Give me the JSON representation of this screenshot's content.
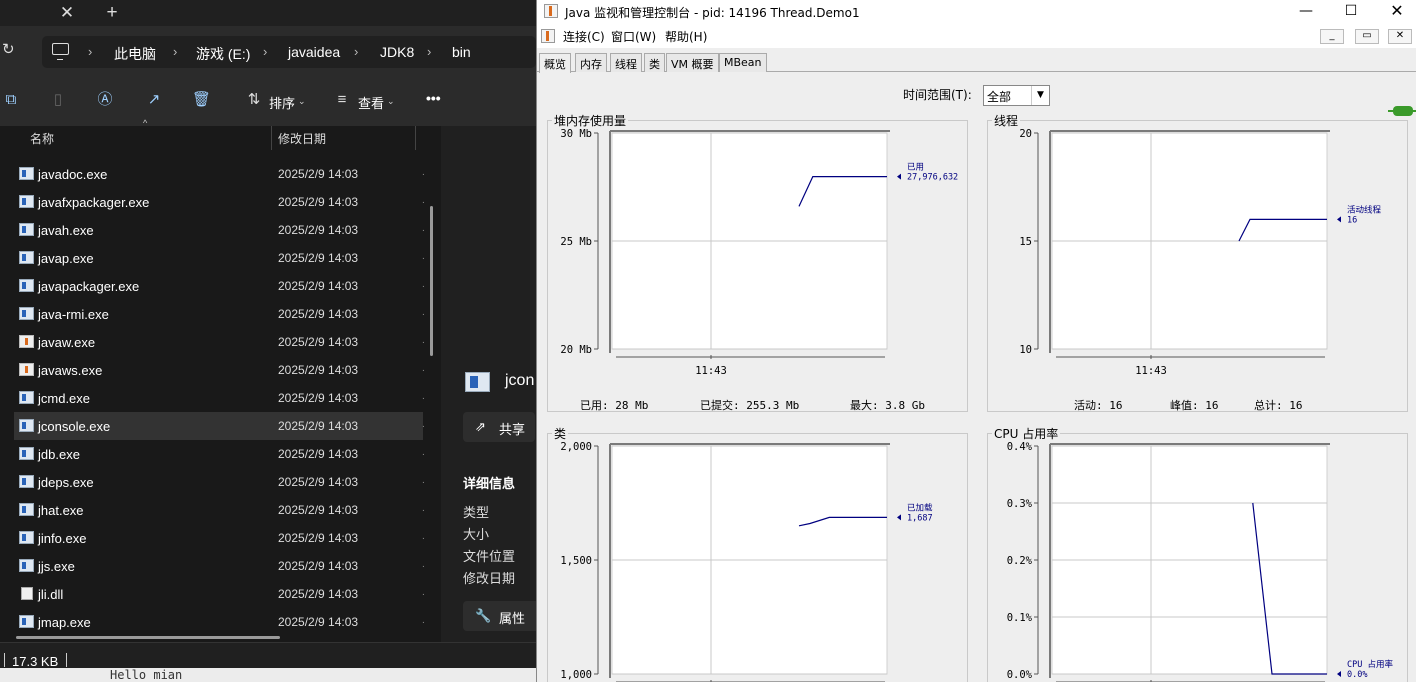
{
  "explorer": {
    "address": {
      "crumbs": [
        "此电脑",
        "游戏 (E:)",
        "javaidea",
        "JDK8",
        "bin"
      ]
    },
    "toolbar": {
      "sort_label": "排序",
      "view_label": "查看",
      "more_label": "•••"
    },
    "columns": {
      "name": "名称",
      "date": "修改日期"
    },
    "files": [
      {
        "name": "javadoc.exe",
        "date": "2025/2/9 14:03",
        "icon": "exe"
      },
      {
        "name": "javafxpackager.exe",
        "date": "2025/2/9 14:03",
        "icon": "exe"
      },
      {
        "name": "javah.exe",
        "date": "2025/2/9 14:03",
        "icon": "exe"
      },
      {
        "name": "javap.exe",
        "date": "2025/2/9 14:03",
        "icon": "exe"
      },
      {
        "name": "javapackager.exe",
        "date": "2025/2/9 14:03",
        "icon": "exe"
      },
      {
        "name": "java-rmi.exe",
        "date": "2025/2/9 14:03",
        "icon": "exe"
      },
      {
        "name": "javaw.exe",
        "date": "2025/2/9 14:03",
        "icon": "java"
      },
      {
        "name": "javaws.exe",
        "date": "2025/2/9 14:03",
        "icon": "java"
      },
      {
        "name": "jcmd.exe",
        "date": "2025/2/9 14:03",
        "icon": "exe"
      },
      {
        "name": "jconsole.exe",
        "date": "2025/2/9 14:03",
        "icon": "exe",
        "selected": true
      },
      {
        "name": "jdb.exe",
        "date": "2025/2/9 14:03",
        "icon": "exe"
      },
      {
        "name": "jdeps.exe",
        "date": "2025/2/9 14:03",
        "icon": "exe"
      },
      {
        "name": "jhat.exe",
        "date": "2025/2/9 14:03",
        "icon": "exe"
      },
      {
        "name": "jinfo.exe",
        "date": "2025/2/9 14:03",
        "icon": "exe"
      },
      {
        "name": "jjs.exe",
        "date": "2025/2/9 14:03",
        "icon": "exe"
      },
      {
        "name": "jli.dll",
        "date": "2025/2/9 14:03",
        "icon": "dll"
      },
      {
        "name": "jmap.exe",
        "date": "2025/2/9 14:03",
        "icon": "exe"
      }
    ],
    "details": {
      "name": "jcon",
      "share_label": "共享",
      "header": "详细信息",
      "labels": [
        "类型",
        "大小",
        "文件位置",
        "修改日期"
      ],
      "properties_label": "属性"
    },
    "status": {
      "size": "17.3 KB"
    },
    "background_text": "Hello mian"
  },
  "jconsole": {
    "title": "Java 监视和管理控制台 - pid: 14196 Thread.Demo1",
    "menu": [
      "连接(C)",
      "窗口(W)",
      "帮助(H)"
    ],
    "tabs": [
      "概览",
      "内存",
      "线程",
      "类",
      "VM 概要",
      "MBean"
    ],
    "time_range_label": "时间范围(T):",
    "time_range_value": "全部",
    "accent": "#000080"
  },
  "chart_data": [
    {
      "type": "line",
      "title": "堆内存使用量",
      "yticks": [
        "30 Mb",
        "25 Mb",
        "20 Mb"
      ],
      "ylim": [
        20,
        30
      ],
      "xlim": [
        0,
        100
      ],
      "xtick": {
        "label": "11:43",
        "x": 36
      },
      "series": [
        {
          "name": "已用",
          "value_label": "27,976,632",
          "x": [
            68,
            73,
            100
          ],
          "y": [
            26.6,
            27.98,
            27.98
          ]
        }
      ],
      "stats": [
        "已用:  28  Mb",
        "已提交:  255.3  Mb",
        "最大:  3.8  Gb"
      ]
    },
    {
      "type": "line",
      "title": "线程",
      "yticks": [
        "20",
        "15",
        "10"
      ],
      "ylim": [
        10,
        20
      ],
      "xlim": [
        0,
        100
      ],
      "xtick": {
        "label": "11:43",
        "x": 36
      },
      "series": [
        {
          "name": "活动线程",
          "value_label": "16",
          "x": [
            68,
            72,
            100
          ],
          "y": [
            15,
            16,
            16
          ]
        }
      ],
      "stats": [
        "活动:  16",
        "峰值:  16",
        "总计:  16"
      ]
    },
    {
      "type": "line",
      "title": "类",
      "yticks": [
        "2,000",
        "1,500",
        "1,000"
      ],
      "ylim": [
        1000,
        2000
      ],
      "xlim": [
        0,
        100
      ],
      "xtick": {
        "label": "",
        "x": 36
      },
      "series": [
        {
          "name": "已加载",
          "value_label": "1,687",
          "x": [
            68,
            72,
            79,
            100
          ],
          "y": [
            1650,
            1660,
            1687,
            1687
          ]
        }
      ],
      "stats": []
    },
    {
      "type": "line",
      "title": "CPU 占用率",
      "yticks": [
        "0.4%",
        "0.3%",
        "0.2%",
        "0.1%",
        "0.0%"
      ],
      "ylim": [
        0,
        0.4
      ],
      "xlim": [
        0,
        100
      ],
      "xtick": {
        "label": "",
        "x": 36
      },
      "series": [
        {
          "name": "CPU 占用率",
          "value_label": "0.0%",
          "x": [
            73,
            80,
            100
          ],
          "y": [
            0.3,
            0.0,
            0.0
          ]
        }
      ],
      "stats": []
    }
  ]
}
